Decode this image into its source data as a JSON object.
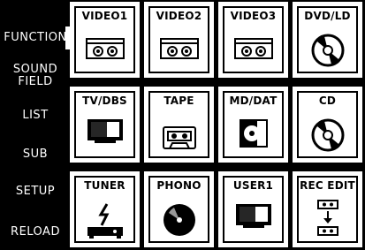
{
  "sidebar": {
    "items": [
      {
        "label": "FUNCTION",
        "active": true
      },
      {
        "label": "SOUND\nFIELD"
      },
      {
        "label": "LIST"
      },
      {
        "label": "SUB"
      },
      {
        "label": "SETUP"
      },
      {
        "label": "RELOAD"
      }
    ]
  },
  "tiles": [
    {
      "label": "VIDEO1",
      "icon": "vcr-cassette-icon"
    },
    {
      "label": "VIDEO2",
      "icon": "vcr-cassette-icon"
    },
    {
      "label": "VIDEO3",
      "icon": "vcr-cassette-icon"
    },
    {
      "label": "DVD/LD",
      "icon": "disc-icon"
    },
    {
      "label": "TV/DBS",
      "icon": "tv-icon"
    },
    {
      "label": "TAPE",
      "icon": "tape-cassette-icon"
    },
    {
      "label": "MD/DAT",
      "icon": "minidisc-icon"
    },
    {
      "label": "CD",
      "icon": "disc-icon"
    },
    {
      "label": "TUNER",
      "icon": "tuner-icon"
    },
    {
      "label": "PHONO",
      "icon": "record-icon"
    },
    {
      "label": "USER1",
      "icon": "tv-icon"
    },
    {
      "label": "REC EDIT",
      "icon": "rec-edit-icon"
    }
  ]
}
